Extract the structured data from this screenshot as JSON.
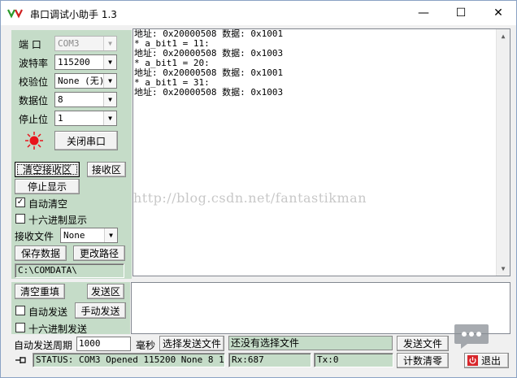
{
  "window": {
    "title": "串口调试小助手 1.3",
    "minimize": "—",
    "maximize": "☐",
    "close": "✕"
  },
  "settings": {
    "port_label": "端  口",
    "port_value": "COM3",
    "baud_label": "波特率",
    "baud_value": "115200",
    "parity_label": "校验位",
    "parity_value": "None (无)",
    "databits_label": "数据位",
    "databits_value": "8",
    "stopbits_label": "停止位",
    "stopbits_value": "1",
    "close_port_button": "关闭串口"
  },
  "receive": {
    "clear_button": "清空接收区",
    "area_button": "接收区",
    "stop_display_button": "停止显示",
    "auto_clear_label": "自动清空",
    "auto_clear_checked": "✓",
    "hex_display_label": "十六进制显示",
    "file_label": "接收文件",
    "file_value": "None",
    "save_button": "保存数据",
    "change_path_button": "更改路径",
    "path": "C:\\COMDATA\\",
    "lines": [
      "地址: 0x20000508 数据: 0x1001",
      "* a_bit1 = 11:",
      "地址: 0x20000508 数据: 0x1003",
      "* a_bit1 = 20:",
      "地址: 0x20000508 数据: 0x1001",
      "* a_bit1 = 31:",
      "地址: 0x20000508 数据: 0x1003"
    ],
    "watermark": "http://blog.csdn.net/fantastikman"
  },
  "send": {
    "clear_button": "清空重填",
    "area_button": "发送区",
    "auto_send_label": "自动发送",
    "manual_send_button": "手动发送",
    "hex_send_label": "十六进制发送",
    "period_label": "自动发送周期",
    "period_value": "1000",
    "ms_label": "毫秒",
    "choose_file_button": "选择发送文件",
    "file_status": "还没有选择文件",
    "send_file_button": "发送文件",
    "reset_count_button": "计数清零",
    "exit_button": "退出"
  },
  "status": {
    "text": "STATUS: COM3 Opened 115200 None  8  1",
    "rx": "Rx:687",
    "tx": "Tx:0"
  },
  "colors": {
    "panel_green": "#c5dcc8",
    "led_red": "#e8141b"
  }
}
